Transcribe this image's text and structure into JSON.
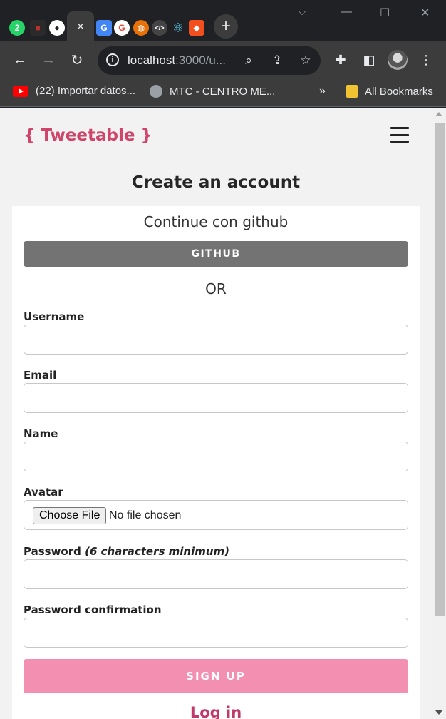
{
  "browser": {
    "tabs": [
      {
        "icon": "whatsapp-icon",
        "color": "#25d366",
        "glyph": "2"
      },
      {
        "icon": "notion-icon",
        "color": "#c03030",
        "glyph": "■"
      },
      {
        "icon": "github-icon",
        "color": "#ffffff",
        "glyph": "●"
      },
      {
        "icon": "google-translate-icon",
        "color": "#4285f4",
        "glyph": "G"
      },
      {
        "icon": "google-icon",
        "color": "#ffffff",
        "glyph": "G"
      },
      {
        "icon": "basketball-icon",
        "color": "#e8710a",
        "glyph": "◍"
      },
      {
        "icon": "code-icon",
        "color": "#444",
        "glyph": "⟨⟩"
      },
      {
        "icon": "react-icon",
        "color": "#61dafb",
        "glyph": "⚛"
      },
      {
        "icon": "figma-icon",
        "color": "#f24e1e",
        "glyph": "◆"
      }
    ],
    "active_tab_close": "×",
    "new_tab": "+",
    "address": {
      "host": "localhost",
      "rest": ":3000/u..."
    },
    "bookmarks": [
      {
        "label": "(22) Importar datos..."
      },
      {
        "label": "MTC - CENTRO ME..."
      }
    ],
    "bookmarks_more": "»",
    "all_bookmarks": "All Bookmarks"
  },
  "page": {
    "logo": "{ Tweetable }",
    "title": "Create an account",
    "continue_text": "Continue con github",
    "github_button": "GITHUB",
    "or_text": "OR",
    "fields": {
      "username_label": "Username",
      "email_label": "Email",
      "name_label": "Name",
      "avatar_label": "Avatar",
      "avatar_button": "Choose File",
      "avatar_status": "No file chosen",
      "password_label": "Password",
      "password_hint": "(6 characters minimum)",
      "password_confirmation_label": "Password confirmation"
    },
    "signup_button": "SIGN UP",
    "login_link": "Log in"
  },
  "colors": {
    "accent": "#d0446a",
    "signup": "#f38fb0",
    "github_button": "#737373"
  }
}
